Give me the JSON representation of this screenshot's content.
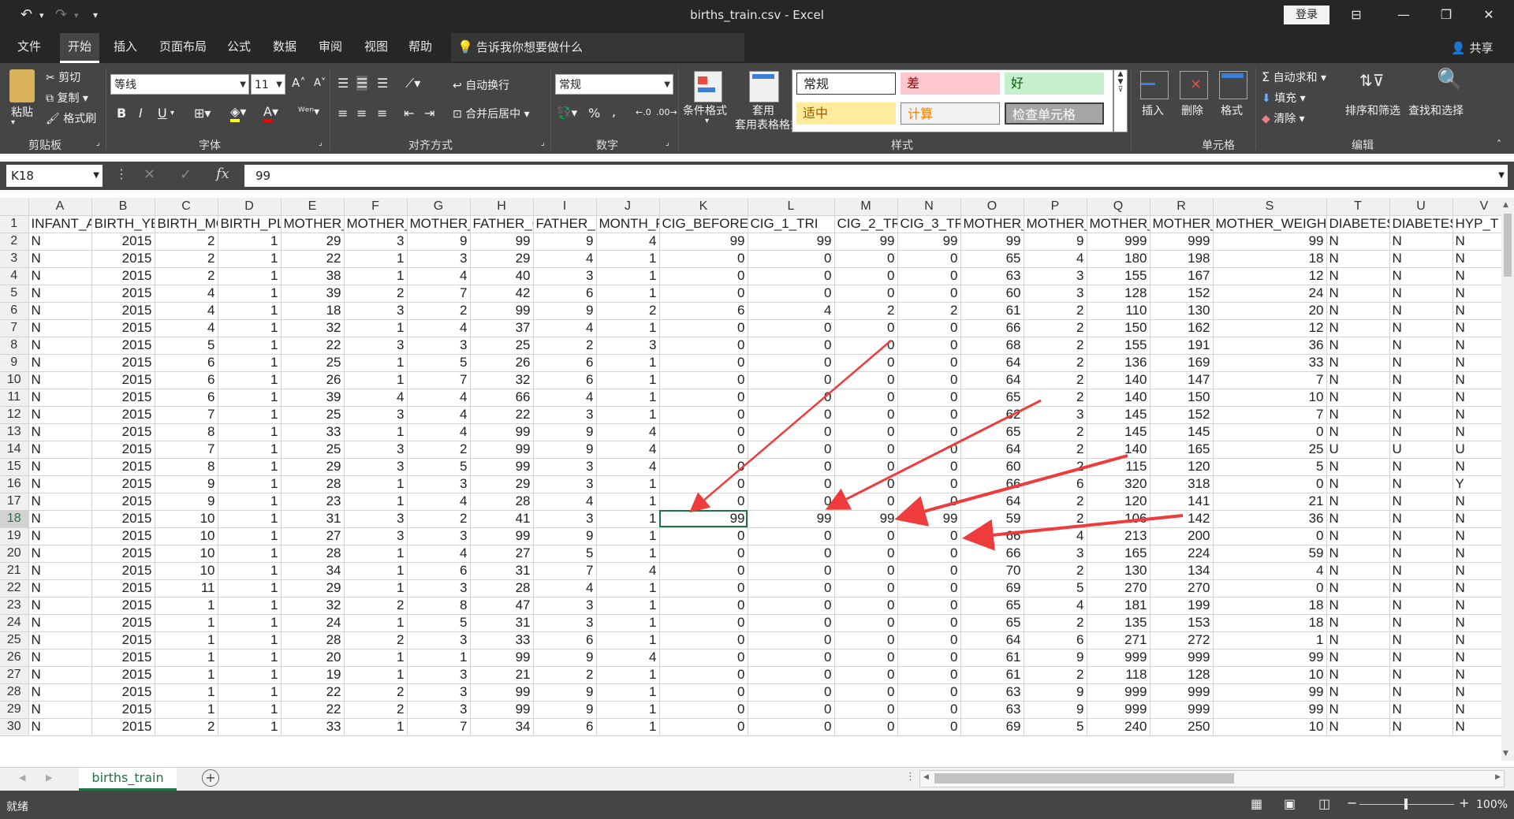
{
  "window": {
    "title": "births_train.csv  -  Excel",
    "login_label": "登录"
  },
  "tabs": [
    "文件",
    "开始",
    "插入",
    "页面布局",
    "公式",
    "数据",
    "审阅",
    "视图",
    "帮助"
  ],
  "tell_me": "告诉我你想要做什么",
  "share_label": "共享",
  "clipboard": {
    "paste": "粘贴",
    "cut": "剪切",
    "copy": "复制",
    "format_painter": "格式刷",
    "group": "剪贴板"
  },
  "font": {
    "name": "等线",
    "size": "11",
    "group": "字体",
    "bold": "B",
    "italic": "I",
    "underline": "U"
  },
  "alignment": {
    "wrap": "自动换行",
    "merge": "合并后居中",
    "group": "对齐方式"
  },
  "number": {
    "format": "常规",
    "percent": "%",
    "comma": ",",
    "group": "数字"
  },
  "styles_group": {
    "conditional": "条件格式",
    "table_format": "套用表格格式",
    "group": "样式",
    "cells": [
      {
        "label": "常规",
        "bg": "#ffffff",
        "fg": "#222222"
      },
      {
        "label": "差",
        "bg": "#ffc7ce",
        "fg": "#9c0006"
      },
      {
        "label": "好",
        "bg": "#c6efce",
        "fg": "#006100"
      },
      {
        "label": "适中",
        "bg": "#ffeb9c",
        "fg": "#9c5700"
      },
      {
        "label": "计算",
        "bg": "#f2f2f2",
        "fg": "#fa7d00"
      },
      {
        "label": "检查单元格",
        "bg": "#a5a5a5",
        "fg": "#ffffff"
      }
    ]
  },
  "cells_group": {
    "insert": "插入",
    "delete": "删除",
    "format": "格式",
    "group": "单元格"
  },
  "editing": {
    "autosum": "自动求和",
    "fill": "填充",
    "clear": "清除",
    "sort": "排序和筛选",
    "find": "查找和选择",
    "group": "编辑"
  },
  "formula_bar": {
    "name_box": "K18",
    "fx": "fx",
    "value": "99"
  },
  "columns": [
    "A",
    "B",
    "C",
    "D",
    "E",
    "F",
    "G",
    "H",
    "I",
    "J",
    "K",
    "L",
    "M",
    "N",
    "O",
    "P",
    "Q",
    "R",
    "S",
    "T",
    "U",
    "V"
  ],
  "header_row": [
    "INFANT_A",
    "BIRTH_YE",
    "BIRTH_MC",
    "BIRTH_PLA",
    "MOTHER_",
    "MOTHER_",
    "MOTHER_E",
    "FATHER_C",
    "FATHER_E",
    "MONTH_P",
    "CIG_BEFORE",
    "CIG_1_TRI",
    "CIG_2_TRI",
    "CIG_3_TRI",
    "MOTHER_",
    "MOTHER_",
    "MOTHER_",
    "MOTHER_",
    "MOTHER_WEIGHT_",
    "DIABETES",
    "DIABETES",
    "HYP_T"
  ],
  "rows": [
    [
      "N",
      "2015",
      "2",
      "1",
      "29",
      "3",
      "9",
      "99",
      "9",
      "4",
      "99",
      "99",
      "99",
      "99",
      "99",
      "9",
      "999",
      "999",
      "99",
      "N",
      "N",
      "N"
    ],
    [
      "N",
      "2015",
      "2",
      "1",
      "22",
      "1",
      "3",
      "29",
      "4",
      "1",
      "0",
      "0",
      "0",
      "0",
      "65",
      "4",
      "180",
      "198",
      "18",
      "N",
      "N",
      "N"
    ],
    [
      "N",
      "2015",
      "2",
      "1",
      "38",
      "1",
      "4",
      "40",
      "3",
      "1",
      "0",
      "0",
      "0",
      "0",
      "63",
      "3",
      "155",
      "167",
      "12",
      "N",
      "N",
      "N"
    ],
    [
      "N",
      "2015",
      "4",
      "1",
      "39",
      "2",
      "7",
      "42",
      "6",
      "1",
      "0",
      "0",
      "0",
      "0",
      "60",
      "3",
      "128",
      "152",
      "24",
      "N",
      "N",
      "N"
    ],
    [
      "N",
      "2015",
      "4",
      "1",
      "18",
      "3",
      "2",
      "99",
      "9",
      "2",
      "6",
      "4",
      "2",
      "2",
      "61",
      "2",
      "110",
      "130",
      "20",
      "N",
      "N",
      "N"
    ],
    [
      "N",
      "2015",
      "4",
      "1",
      "32",
      "1",
      "4",
      "37",
      "4",
      "1",
      "0",
      "0",
      "0",
      "0",
      "66",
      "2",
      "150",
      "162",
      "12",
      "N",
      "N",
      "N"
    ],
    [
      "N",
      "2015",
      "5",
      "1",
      "22",
      "3",
      "3",
      "25",
      "2",
      "3",
      "0",
      "0",
      "0",
      "0",
      "68",
      "2",
      "155",
      "191",
      "36",
      "N",
      "N",
      "N"
    ],
    [
      "N",
      "2015",
      "6",
      "1",
      "25",
      "1",
      "5",
      "26",
      "6",
      "1",
      "0",
      "0",
      "0",
      "0",
      "64",
      "2",
      "136",
      "169",
      "33",
      "N",
      "N",
      "N"
    ],
    [
      "N",
      "2015",
      "6",
      "1",
      "26",
      "1",
      "7",
      "32",
      "6",
      "1",
      "0",
      "0",
      "0",
      "0",
      "64",
      "2",
      "140",
      "147",
      "7",
      "N",
      "N",
      "N"
    ],
    [
      "N",
      "2015",
      "6",
      "1",
      "39",
      "4",
      "4",
      "66",
      "4",
      "1",
      "0",
      "0",
      "0",
      "0",
      "65",
      "2",
      "140",
      "150",
      "10",
      "N",
      "N",
      "N"
    ],
    [
      "N",
      "2015",
      "7",
      "1",
      "25",
      "3",
      "4",
      "22",
      "3",
      "1",
      "0",
      "0",
      "0",
      "0",
      "62",
      "3",
      "145",
      "152",
      "7",
      "N",
      "N",
      "N"
    ],
    [
      "N",
      "2015",
      "8",
      "1",
      "33",
      "1",
      "4",
      "99",
      "9",
      "4",
      "0",
      "0",
      "0",
      "0",
      "65",
      "2",
      "145",
      "145",
      "0",
      "N",
      "N",
      "N"
    ],
    [
      "N",
      "2015",
      "7",
      "1",
      "25",
      "3",
      "2",
      "99",
      "9",
      "4",
      "0",
      "0",
      "0",
      "0",
      "64",
      "2",
      "140",
      "165",
      "25",
      "U",
      "U",
      "U"
    ],
    [
      "N",
      "2015",
      "8",
      "1",
      "29",
      "3",
      "5",
      "99",
      "3",
      "4",
      "0",
      "0",
      "0",
      "0",
      "60",
      "2",
      "115",
      "120",
      "5",
      "N",
      "N",
      "N"
    ],
    [
      "N",
      "2015",
      "9",
      "1",
      "28",
      "1",
      "3",
      "29",
      "3",
      "1",
      "0",
      "0",
      "0",
      "0",
      "66",
      "6",
      "320",
      "318",
      "0",
      "N",
      "N",
      "Y"
    ],
    [
      "N",
      "2015",
      "9",
      "1",
      "23",
      "1",
      "4",
      "28",
      "4",
      "1",
      "0",
      "0",
      "0",
      "0",
      "64",
      "2",
      "120",
      "141",
      "21",
      "N",
      "N",
      "N"
    ],
    [
      "N",
      "2015",
      "10",
      "1",
      "31",
      "3",
      "2",
      "41",
      "3",
      "1",
      "99",
      "99",
      "99",
      "99",
      "59",
      "2",
      "106",
      "142",
      "36",
      "N",
      "N",
      "N"
    ],
    [
      "N",
      "2015",
      "10",
      "1",
      "27",
      "3",
      "3",
      "99",
      "9",
      "1",
      "0",
      "0",
      "0",
      "0",
      "66",
      "4",
      "213",
      "200",
      "0",
      "N",
      "N",
      "N"
    ],
    [
      "N",
      "2015",
      "10",
      "1",
      "28",
      "1",
      "4",
      "27",
      "5",
      "1",
      "0",
      "0",
      "0",
      "0",
      "66",
      "3",
      "165",
      "224",
      "59",
      "N",
      "N",
      "N"
    ],
    [
      "N",
      "2015",
      "10",
      "1",
      "34",
      "1",
      "6",
      "31",
      "7",
      "4",
      "0",
      "0",
      "0",
      "0",
      "70",
      "2",
      "130",
      "134",
      "4",
      "N",
      "N",
      "N"
    ],
    [
      "N",
      "2015",
      "11",
      "1",
      "29",
      "1",
      "3",
      "28",
      "4",
      "1",
      "0",
      "0",
      "0",
      "0",
      "69",
      "5",
      "270",
      "270",
      "0",
      "N",
      "N",
      "N"
    ],
    [
      "N",
      "2015",
      "1",
      "1",
      "32",
      "2",
      "8",
      "47",
      "3",
      "1",
      "0",
      "0",
      "0",
      "0",
      "65",
      "4",
      "181",
      "199",
      "18",
      "N",
      "N",
      "N"
    ],
    [
      "N",
      "2015",
      "1",
      "1",
      "24",
      "1",
      "5",
      "31",
      "3",
      "1",
      "0",
      "0",
      "0",
      "0",
      "65",
      "2",
      "135",
      "153",
      "18",
      "N",
      "N",
      "N"
    ],
    [
      "N",
      "2015",
      "1",
      "1",
      "28",
      "2",
      "3",
      "33",
      "6",
      "1",
      "0",
      "0",
      "0",
      "0",
      "64",
      "6",
      "271",
      "272",
      "1",
      "N",
      "N",
      "N"
    ],
    [
      "N",
      "2015",
      "1",
      "1",
      "20",
      "1",
      "1",
      "99",
      "9",
      "4",
      "0",
      "0",
      "0",
      "0",
      "61",
      "9",
      "999",
      "999",
      "99",
      "N",
      "N",
      "N"
    ],
    [
      "N",
      "2015",
      "1",
      "1",
      "19",
      "1",
      "3",
      "21",
      "2",
      "1",
      "0",
      "0",
      "0",
      "0",
      "61",
      "2",
      "118",
      "128",
      "10",
      "N",
      "N",
      "N"
    ],
    [
      "N",
      "2015",
      "1",
      "1",
      "22",
      "2",
      "3",
      "99",
      "9",
      "1",
      "0",
      "0",
      "0",
      "0",
      "63",
      "9",
      "999",
      "999",
      "99",
      "N",
      "N",
      "N"
    ],
    [
      "N",
      "2015",
      "1",
      "1",
      "22",
      "2",
      "3",
      "99",
      "9",
      "1",
      "0",
      "0",
      "0",
      "0",
      "63",
      "9",
      "999",
      "999",
      "99",
      "N",
      "N",
      "N"
    ],
    [
      "N",
      "2015",
      "2",
      "1",
      "33",
      "1",
      "7",
      "34",
      "6",
      "1",
      "0",
      "0",
      "0",
      "0",
      "69",
      "5",
      "240",
      "250",
      "10",
      "N",
      "N",
      "N"
    ]
  ],
  "sheet_tab": "births_train",
  "status": {
    "ready": "就绪",
    "zoom": "100%"
  }
}
